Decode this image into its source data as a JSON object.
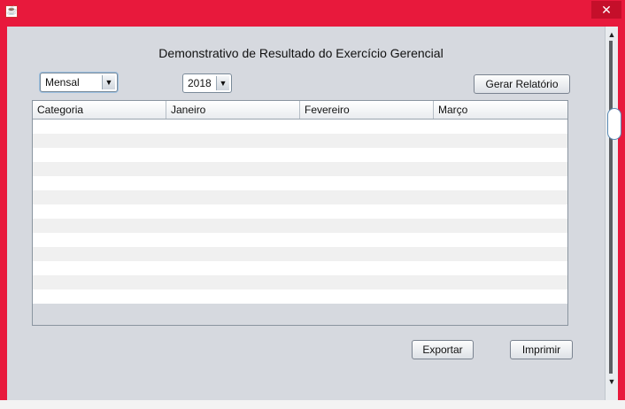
{
  "window": {
    "close_label": "✕",
    "app_icon_glyph": "☕",
    "accent_color": "#e8193c"
  },
  "report": {
    "title": "Demonstrativo de Resultado do Exercício Gerencial"
  },
  "filters": {
    "period_value": "Mensal",
    "year_value": "2018",
    "dropdown_arrow": "▼"
  },
  "buttons": {
    "generate_label": "Gerar Relatório",
    "export_label": "Exportar",
    "print_label": "Imprimir"
  },
  "table": {
    "columns": [
      "Categoria",
      "Janeiro",
      "Fevereiro",
      "Março"
    ],
    "rows": []
  },
  "scrollbar": {
    "up_arrow": "▲",
    "down_arrow": "▼"
  }
}
